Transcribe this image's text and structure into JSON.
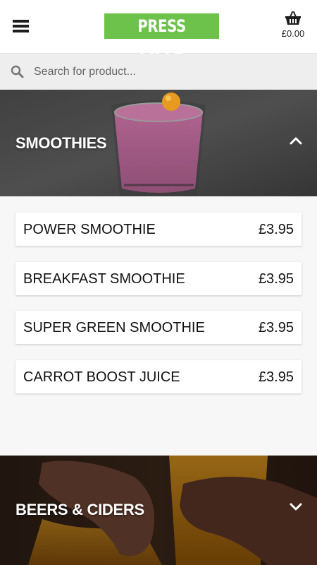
{
  "header": {
    "logo_text": "PRESS PIZZA",
    "basket_total": "£0.00",
    "colors": {
      "logo_bg": "#6cc24a"
    }
  },
  "search": {
    "placeholder": "Search for product..."
  },
  "categories": [
    {
      "title": "SMOOTHIES",
      "expanded": true,
      "products": [
        {
          "name": "POWER SMOOTHIE",
          "price": "£3.95"
        },
        {
          "name": "BREAKFAST SMOOTHIE",
          "price": "£3.95"
        },
        {
          "name": "SUPER GREEN SMOOTHIE",
          "price": "£3.95"
        },
        {
          "name": "CARROT BOOST JUICE",
          "price": "£3.95"
        }
      ]
    },
    {
      "title": "BEERS & CIDERS",
      "expanded": false
    }
  ],
  "icons": {
    "menu": "hamburger-menu-icon",
    "basket": "basket-icon",
    "search": "search-icon",
    "collapse": "chevron-up-icon",
    "expand": "chevron-down-icon"
  }
}
